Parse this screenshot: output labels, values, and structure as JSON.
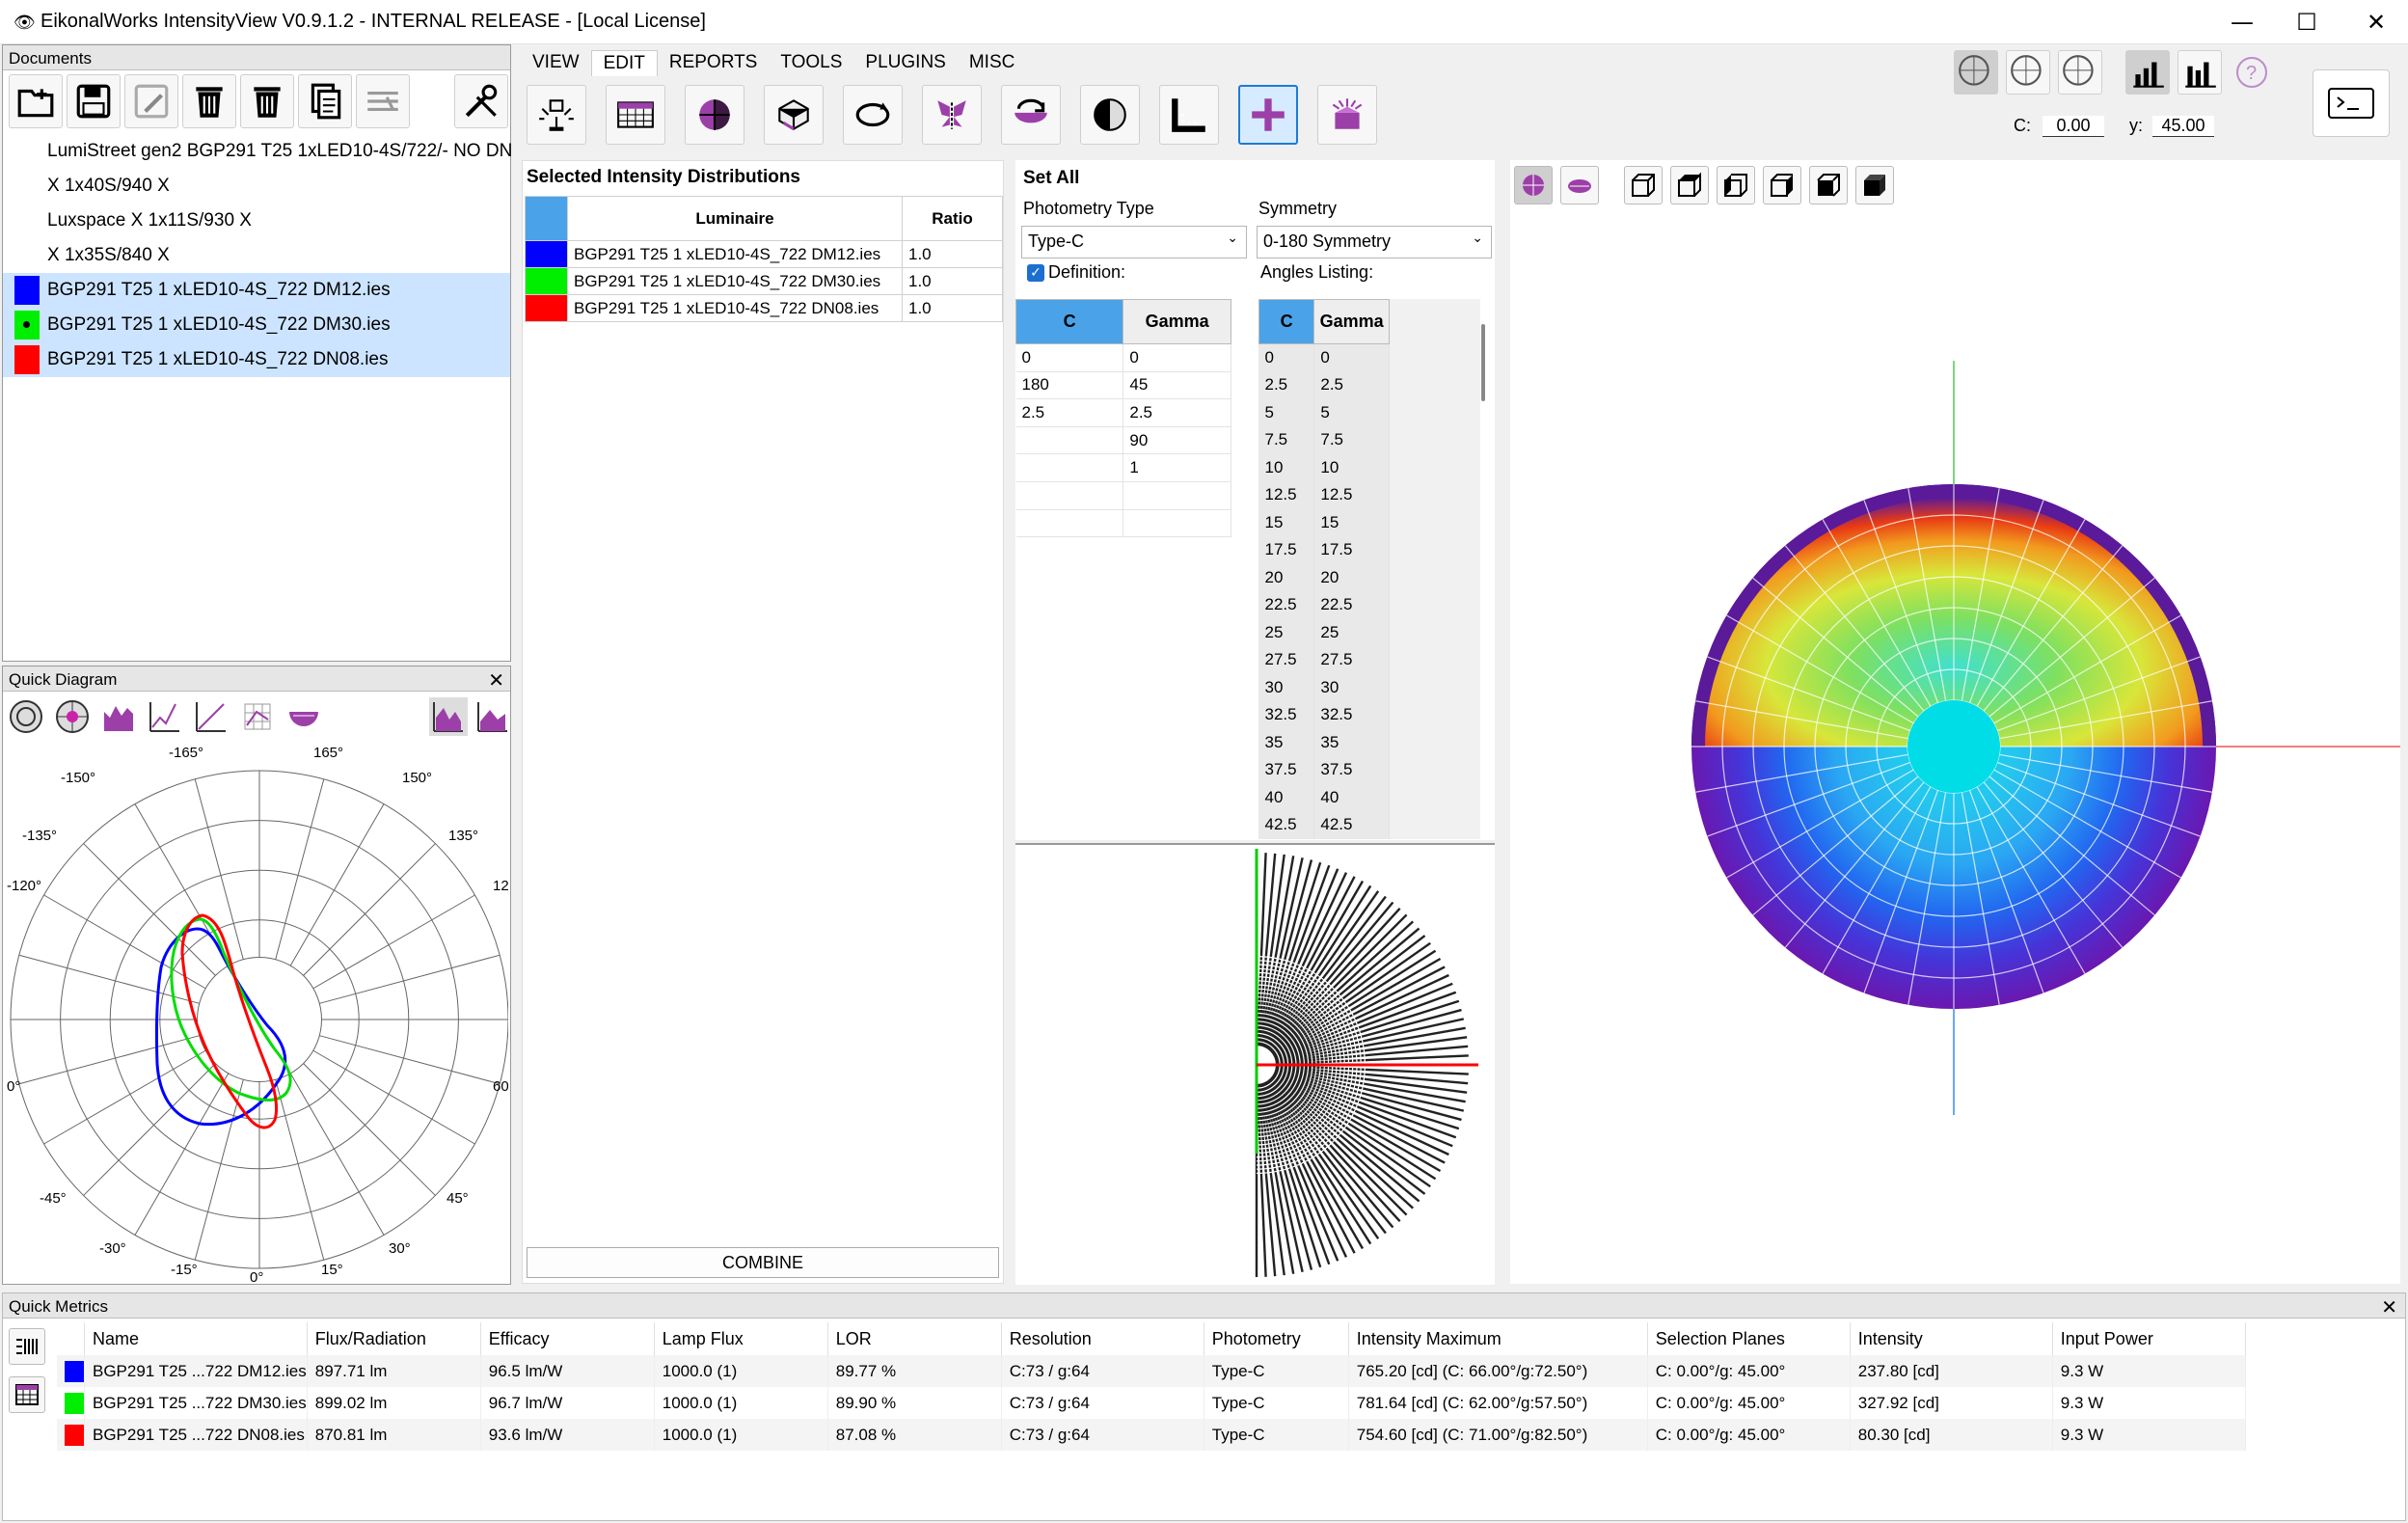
{
  "app": {
    "title": "EikonalWorks IntensityView V0.9.1.2 - INTERNAL RELEASE - [Local License]",
    "minimize": "—",
    "maximize": "☐",
    "close": "✕"
  },
  "documents": {
    "header": "Documents",
    "items": [
      {
        "label": "LumiStreet gen2 BGP291 T25 1xLED10-4S/722/- NO DN"
      },
      {
        "label": "X 1x40S/940 X"
      },
      {
        "label": "Luxspace X 1x11S/930 X"
      },
      {
        "label": "X 1x35S/840 X"
      },
      {
        "label": "BGP291 T25 1 xLED10-4S_722 DM12.ies",
        "color": "#0000ff"
      },
      {
        "label": "BGP291 T25 1 xLED10-4S_722 DM30.ies",
        "color": "#00ee00"
      },
      {
        "label": "BGP291 T25 1 xLED10-4S_722 DN08.ies",
        "color": "#ff0000"
      }
    ]
  },
  "menu": [
    "VIEW",
    "EDIT",
    "REPORTS",
    "TOOLS",
    "PLUGINS",
    "MISC"
  ],
  "coords": {
    "c_label": "C:",
    "c_value": "0.00",
    "y_label": "y:",
    "y_value": "45.00"
  },
  "quick_diagram": {
    "header": "Quick Diagram",
    "close": "✕",
    "labels": {
      "top_left": "-165°",
      "top_right": "165°",
      "ul": "-150°",
      "ur": "150°",
      "ml": "-135°",
      "mr": "135°",
      "left120": "-120°",
      "right120": "12",
      "left90": "0°",
      "right90": "60",
      "ll": "-45°",
      "lr": "45°",
      "bl": "-30°",
      "br": "30°",
      "bbl": "-15°",
      "bbr": "15°",
      "bottom": "0°"
    }
  },
  "selected": {
    "header": "Selected Intensity Distributions",
    "col_luminaire": "Luminaire",
    "col_ratio": "Ratio",
    "rows": [
      {
        "name": "BGP291 T25 1 xLED10-4S_722 DM12.ies",
        "ratio": "1.0",
        "color": "#0000ff"
      },
      {
        "name": "BGP291 T25 1 xLED10-4S_722 DM30.ies",
        "ratio": "1.0",
        "color": "#00ee00"
      },
      {
        "name": "BGP291 T25 1 xLED10-4S_722 DN08.ies",
        "ratio": "1.0",
        "color": "#ff0000"
      }
    ],
    "combine": "COMBINE"
  },
  "setall": {
    "header": "Set All",
    "photometry_label": "Photometry Type",
    "photometry_value": "Type-C",
    "symmetry_label": "Symmetry",
    "symmetry_value": "0-180 Symmetry",
    "definition": "Definition:",
    "angles_listing": "Angles Listing:",
    "def_cols": [
      "C",
      "Gamma"
    ],
    "def_rows": [
      [
        "0",
        "0"
      ],
      [
        "180",
        "45"
      ],
      [
        "2.5",
        "2.5"
      ],
      [
        "",
        "90"
      ],
      [
        "",
        "1"
      ],
      [
        "",
        ""
      ],
      [
        "",
        ""
      ]
    ],
    "ang_cols": [
      "C",
      "Gamma"
    ],
    "ang_rows": [
      [
        "0",
        "0"
      ],
      [
        "2.5",
        "2.5"
      ],
      [
        "5",
        "5"
      ],
      [
        "7.5",
        "7.5"
      ],
      [
        "10",
        "10"
      ],
      [
        "12.5",
        "12.5"
      ],
      [
        "15",
        "15"
      ],
      [
        "17.5",
        "17.5"
      ],
      [
        "20",
        "20"
      ],
      [
        "22.5",
        "22.5"
      ],
      [
        "25",
        "25"
      ],
      [
        "27.5",
        "27.5"
      ],
      [
        "30",
        "30"
      ],
      [
        "32.5",
        "32.5"
      ],
      [
        "35",
        "35"
      ],
      [
        "37.5",
        "37.5"
      ],
      [
        "40",
        "40"
      ],
      [
        "42.5",
        "42.5"
      ]
    ]
  },
  "quick_metrics": {
    "header": "Quick Metrics",
    "close": "✕",
    "columns": [
      "Name",
      "Flux/Radiation",
      "Efficacy",
      "Lamp Flux",
      "LOR",
      "Resolution",
      "Photometry",
      "Intensity Maximum",
      "Selection Planes",
      "Intensity",
      "Input Power"
    ],
    "rows": [
      {
        "color": "#0000ff",
        "cells": [
          "BGP291 T25 ...722 DM12.ies",
          "897.71 lm",
          "96.5 lm/W",
          "1000.0 (1)",
          "89.77 %",
          "C:73 / g:64",
          "Type-C",
          "765.20 [cd] (C: 66.00°/g:72.50°)",
          "C: 0.00°/g: 45.00°",
          "237.80 [cd]",
          "9.3 W"
        ]
      },
      {
        "color": "#00ee00",
        "cells": [
          "BGP291 T25 ...722 DM30.ies",
          "899.02 lm",
          "96.7 lm/W",
          "1000.0 (1)",
          "89.90 %",
          "C:73 / g:64",
          "Type-C",
          "781.64 [cd] (C: 62.00°/g:57.50°)",
          "C: 0.00°/g: 45.00°",
          "327.92 [cd]",
          "9.3 W"
        ]
      },
      {
        "color": "#ff0000",
        "cells": [
          "BGP291 T25 ...722 DN08.ies",
          "870.81 lm",
          "93.6 lm/W",
          "1000.0 (1)",
          "87.08 %",
          "C:73 / g:64",
          "Type-C",
          "754.60 [cd] (C: 71.00°/g:82.50°)",
          "C: 0.00°/g: 45.00°",
          "80.30 [cd]",
          "9.3 W"
        ]
      }
    ]
  }
}
